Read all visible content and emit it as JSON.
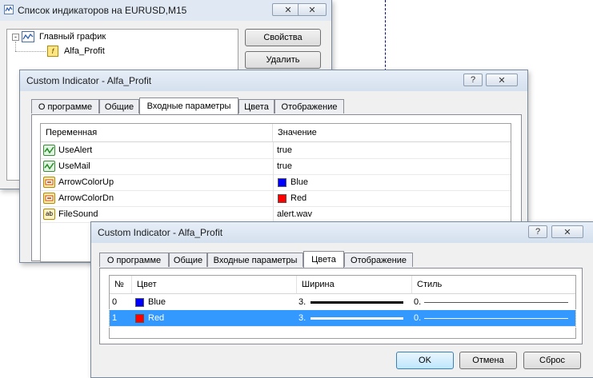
{
  "indicator_list_window": {
    "title": "Список индикаторов на EURUSD,M15",
    "close_symbol": "✕",
    "tree_root": "Главный график",
    "tree_child": "Alfa_Profit",
    "properties_button": "Свойства",
    "delete_button": "Удалить"
  },
  "window_controls": {
    "help": "?",
    "close": "✕"
  },
  "back_dialog": {
    "title": "Custom Indicator - Alfa_Profit",
    "tabs": [
      "О программе",
      "Общие",
      "Входные параметры",
      "Цвета",
      "Отображение"
    ],
    "active_tab": "Входные параметры",
    "columns": {
      "variable": "Переменная",
      "value": "Значение"
    },
    "params": [
      {
        "name": "UseAlert",
        "value": "true",
        "icon": "bool-icon",
        "color": ""
      },
      {
        "name": "UseMail",
        "value": "true",
        "icon": "bool-icon",
        "color": ""
      },
      {
        "name": "ArrowColorUp",
        "value": "Blue",
        "icon": "color-icon",
        "color": "#0000ff"
      },
      {
        "name": "ArrowColorDn",
        "value": "Red",
        "icon": "color-icon",
        "color": "#ff0000"
      },
      {
        "name": "FileSound",
        "value": "alert.wav",
        "icon": "string-icon",
        "color": ""
      }
    ]
  },
  "front_dialog": {
    "title": "Custom Indicator - Alfa_Profit",
    "tabs": [
      "О программе",
      "Общие",
      "Входные параметры",
      "Цвета",
      "Отображение"
    ],
    "active_tab": "Цвета",
    "columns": {
      "num": "№",
      "color": "Цвет",
      "width": "Ширина",
      "style": "Стиль"
    },
    "rows": [
      {
        "num": "0",
        "color_name": "Blue",
        "swatch": "#0000ff",
        "width": "3.",
        "style": "0.",
        "selected": false
      },
      {
        "num": "1",
        "color_name": "Red",
        "swatch": "#ff0000",
        "width": "3.",
        "style": "0.",
        "selected": true
      }
    ],
    "ok_button": "OK",
    "cancel_button": "Отмена",
    "reset_button": "Сброс"
  }
}
